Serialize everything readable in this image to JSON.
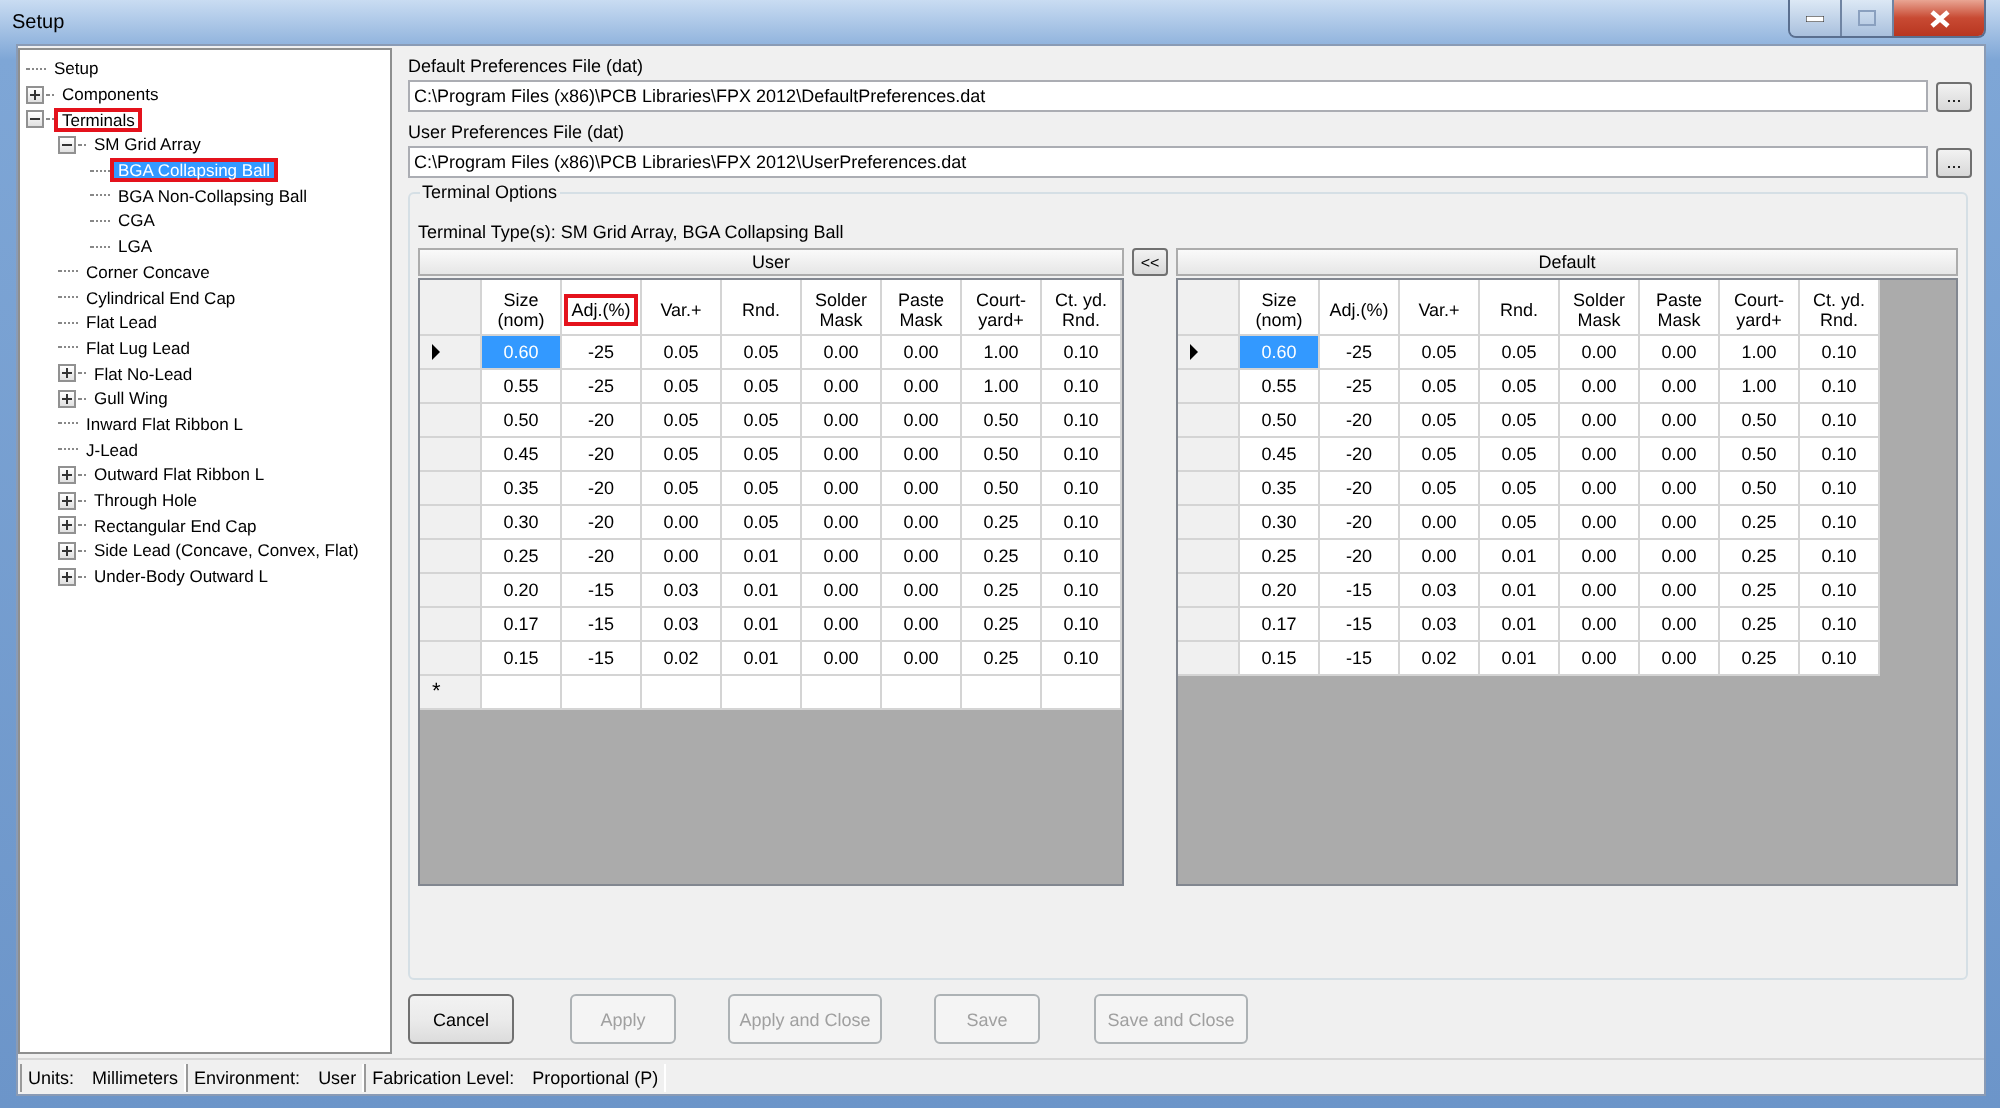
{
  "window": {
    "title": "Setup"
  },
  "tree": [
    {
      "label": "Setup",
      "highlighted": false,
      "selected": false
    },
    {
      "label": "Components",
      "expanded": false,
      "highlighted": false,
      "selected": false
    },
    {
      "label": "Terminals",
      "expanded": true,
      "highlighted": true,
      "selected": false,
      "children": [
        {
          "label": "SM Grid Array",
          "expanded": true,
          "highlighted": false,
          "selected": false,
          "children": [
            {
              "label": "BGA Collapsing Ball",
              "highlighted": true,
              "selected": true
            },
            {
              "label": "BGA Non-Collapsing Ball",
              "highlighted": false,
              "selected": false
            },
            {
              "label": "CGA",
              "highlighted": false,
              "selected": false
            },
            {
              "label": "LGA",
              "highlighted": false,
              "selected": false
            }
          ]
        },
        {
          "label": "Corner Concave",
          "highlighted": false,
          "selected": false
        },
        {
          "label": "Cylindrical End Cap",
          "highlighted": false,
          "selected": false
        },
        {
          "label": "Flat Lead",
          "highlighted": false,
          "selected": false
        },
        {
          "label": "Flat Lug Lead",
          "highlighted": false,
          "selected": false
        },
        {
          "label": "Flat No-Lead",
          "expanded": false,
          "highlighted": false,
          "selected": false
        },
        {
          "label": "Gull Wing",
          "expanded": false,
          "highlighted": false,
          "selected": false
        },
        {
          "label": "Inward Flat Ribbon L",
          "highlighted": false,
          "selected": false
        },
        {
          "label": "J-Lead",
          "highlighted": false,
          "selected": false
        },
        {
          "label": "Outward Flat Ribbon L",
          "expanded": false,
          "highlighted": false,
          "selected": false
        },
        {
          "label": "Through Hole",
          "expanded": false,
          "highlighted": false,
          "selected": false
        },
        {
          "label": "Rectangular End Cap",
          "expanded": false,
          "highlighted": false,
          "selected": false
        },
        {
          "label": "Side Lead (Concave, Convex, Flat)",
          "expanded": false,
          "highlighted": false,
          "selected": false
        },
        {
          "label": "Under-Body Outward L",
          "expanded": false,
          "highlighted": false,
          "selected": false
        }
      ]
    }
  ],
  "preference_files": [
    {
      "label": "Default Preferences File  (dat)",
      "value": "C:\\Program Files (x86)\\PCB Libraries\\FPX 2012\\DefaultPreferences.dat",
      "browse": "..."
    },
    {
      "label": "User Preferences File  (dat)",
      "value": "C:\\Program Files (x86)\\PCB Libraries\\FPX 2012\\UserPreferences.dat",
      "browse": "..."
    }
  ],
  "terminal_options": {
    "title": "Terminal Options",
    "terminal_types": "Terminal Type(s): SM Grid Array, BGA Collapsing Ball",
    "swap_button": "<<",
    "grids": [
      {
        "title": "User",
        "new_row_marker": "*",
        "columns": [
          {
            "label": "Size\n(nom)",
            "highlighted": false
          },
          {
            "label": "Adj.(%)",
            "highlighted": true
          },
          {
            "label": "Var.+",
            "highlighted": false
          },
          {
            "label": "Rnd.",
            "highlighted": false
          },
          {
            "label": "Solder\nMask",
            "highlighted": false
          },
          {
            "label": "Paste\nMask",
            "highlighted": false
          },
          {
            "label": "Court-\nyard+",
            "highlighted": false
          },
          {
            "label": "Ct. yd.\nRnd.",
            "highlighted": false
          }
        ],
        "rows": [
          {
            "current": true,
            "cells": [
              "0.60",
              "-25",
              "0.05",
              "0.05",
              "0.00",
              "0.00",
              "1.00",
              "0.10"
            ]
          },
          {
            "current": false,
            "cells": [
              "0.55",
              "-25",
              "0.05",
              "0.05",
              "0.00",
              "0.00",
              "1.00",
              "0.10"
            ]
          },
          {
            "current": false,
            "cells": [
              "0.50",
              "-20",
              "0.05",
              "0.05",
              "0.00",
              "0.00",
              "0.50",
              "0.10"
            ]
          },
          {
            "current": false,
            "cells": [
              "0.45",
              "-20",
              "0.05",
              "0.05",
              "0.00",
              "0.00",
              "0.50",
              "0.10"
            ]
          },
          {
            "current": false,
            "cells": [
              "0.35",
              "-20",
              "0.05",
              "0.05",
              "0.00",
              "0.00",
              "0.50",
              "0.10"
            ]
          },
          {
            "current": false,
            "cells": [
              "0.30",
              "-20",
              "0.00",
              "0.05",
              "0.00",
              "0.00",
              "0.25",
              "0.10"
            ]
          },
          {
            "current": false,
            "cells": [
              "0.25",
              "-20",
              "0.00",
              "0.01",
              "0.00",
              "0.00",
              "0.25",
              "0.10"
            ]
          },
          {
            "current": false,
            "cells": [
              "0.20",
              "-15",
              "0.03",
              "0.01",
              "0.00",
              "0.00",
              "0.25",
              "0.10"
            ]
          },
          {
            "current": false,
            "cells": [
              "0.17",
              "-15",
              "0.03",
              "0.01",
              "0.00",
              "0.00",
              "0.25",
              "0.10"
            ]
          },
          {
            "current": false,
            "cells": [
              "0.15",
              "-15",
              "0.02",
              "0.01",
              "0.00",
              "0.00",
              "0.25",
              "0.10"
            ]
          }
        ]
      },
      {
        "title": "Default",
        "columns": [
          {
            "label": "Size\n(nom)",
            "highlighted": false
          },
          {
            "label": "Adj.(%)",
            "highlighted": false
          },
          {
            "label": "Var.+",
            "highlighted": false
          },
          {
            "label": "Rnd.",
            "highlighted": false
          },
          {
            "label": "Solder\nMask",
            "highlighted": false
          },
          {
            "label": "Paste\nMask",
            "highlighted": false
          },
          {
            "label": "Court-\nyard+",
            "highlighted": false
          },
          {
            "label": "Ct. yd.\nRnd.",
            "highlighted": false
          }
        ],
        "rows": [
          {
            "current": true,
            "cells": [
              "0.60",
              "-25",
              "0.05",
              "0.05",
              "0.00",
              "0.00",
              "1.00",
              "0.10"
            ]
          },
          {
            "current": false,
            "cells": [
              "0.55",
              "-25",
              "0.05",
              "0.05",
              "0.00",
              "0.00",
              "1.00",
              "0.10"
            ]
          },
          {
            "current": false,
            "cells": [
              "0.50",
              "-20",
              "0.05",
              "0.05",
              "0.00",
              "0.00",
              "0.50",
              "0.10"
            ]
          },
          {
            "current": false,
            "cells": [
              "0.45",
              "-20",
              "0.05",
              "0.05",
              "0.00",
              "0.00",
              "0.50",
              "0.10"
            ]
          },
          {
            "current": false,
            "cells": [
              "0.35",
              "-20",
              "0.05",
              "0.05",
              "0.00",
              "0.00",
              "0.50",
              "0.10"
            ]
          },
          {
            "current": false,
            "cells": [
              "0.30",
              "-20",
              "0.00",
              "0.05",
              "0.00",
              "0.00",
              "0.25",
              "0.10"
            ]
          },
          {
            "current": false,
            "cells": [
              "0.25",
              "-20",
              "0.00",
              "0.01",
              "0.00",
              "0.00",
              "0.25",
              "0.10"
            ]
          },
          {
            "current": false,
            "cells": [
              "0.20",
              "-15",
              "0.03",
              "0.01",
              "0.00",
              "0.00",
              "0.25",
              "0.10"
            ]
          },
          {
            "current": false,
            "cells": [
              "0.17",
              "-15",
              "0.03",
              "0.01",
              "0.00",
              "0.00",
              "0.25",
              "0.10"
            ]
          },
          {
            "current": false,
            "cells": [
              "0.15",
              "-15",
              "0.02",
              "0.01",
              "0.00",
              "0.00",
              "0.25",
              "0.10"
            ]
          }
        ]
      }
    ]
  },
  "buttons": [
    {
      "label": "Cancel",
      "disabled": false
    },
    {
      "label": "Apply",
      "disabled": true
    },
    {
      "label": "Apply and Close",
      "disabled": true
    },
    {
      "label": "Save",
      "disabled": true
    },
    {
      "label": "Save and Close",
      "disabled": true
    }
  ],
  "status_bar": [
    {
      "label": "Units:",
      "value": "Millimeters"
    },
    {
      "label": "Environment:",
      "value": "User"
    },
    {
      "label": "Fabrication Level:",
      "value": "Proportional (P)"
    }
  ]
}
